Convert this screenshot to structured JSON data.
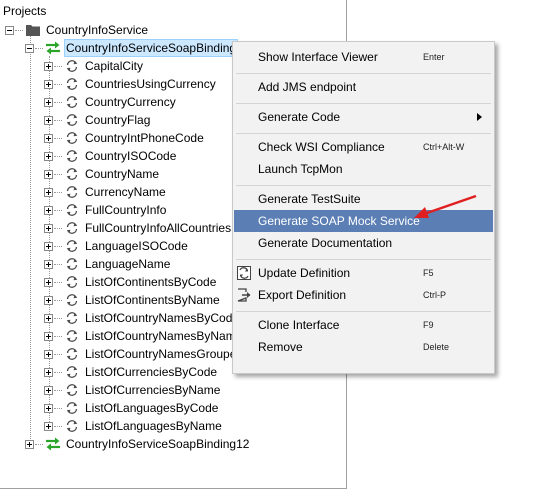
{
  "panel": {
    "header": "Projects",
    "project": "CountryInfoService",
    "binding": "CountryInfoServiceSoapBinding",
    "operations": [
      "CapitalCity",
      "CountriesUsingCurrency",
      "CountryCurrency",
      "CountryFlag",
      "CountryIntPhoneCode",
      "CountryISOCode",
      "CountryName",
      "CurrencyName",
      "FullCountryInfo",
      "FullCountryInfoAllCountries",
      "LanguageISOCode",
      "LanguageName",
      "ListOfContinentsByCode",
      "ListOfContinentsByName",
      "ListOfCountryNamesByCode",
      "ListOfCountryNamesByName",
      "ListOfCountryNamesGrouped",
      "ListOfCurrenciesByCode",
      "ListOfCurrenciesByName",
      "ListOfLanguagesByCode",
      "ListOfLanguagesByName"
    ],
    "binding2": "CountryInfoServiceSoapBinding12"
  },
  "menu": {
    "items": [
      {
        "label": "Show Interface Viewer",
        "shortcut": "Enter"
      },
      {
        "label": "Add JMS endpoint",
        "shortcut": ""
      },
      {
        "label": "Generate Code",
        "shortcut": ""
      },
      {
        "label": "Check WSI Compliance",
        "shortcut": "Ctrl+Alt-W"
      },
      {
        "label": "Launch TcpMon",
        "shortcut": ""
      },
      {
        "label": "Generate TestSuite",
        "shortcut": ""
      },
      {
        "label": "Generate SOAP Mock Service",
        "shortcut": ""
      },
      {
        "label": "Generate Documentation",
        "shortcut": ""
      },
      {
        "label": "Update Definition",
        "shortcut": "F5"
      },
      {
        "label": "Export Definition",
        "shortcut": "Ctrl-P"
      },
      {
        "label": "Clone Interface",
        "shortcut": "F9"
      },
      {
        "label": "Remove",
        "shortcut": "Delete"
      }
    ]
  },
  "colors": {
    "highlight": "#5b7fb4",
    "selection": "#cce8ff",
    "refresh_icon": "#4a4a4a",
    "binding_icon": "#2aa52a",
    "annotation_arrow": "#e02020"
  },
  "icons": {
    "project": "folder-icon",
    "binding": "interface-arrows-icon",
    "operation": "refresh-cycle-icon",
    "update": "update-definition-icon",
    "export": "export-definition-icon",
    "submenu": "submenu-arrow-icon",
    "annotation": "red-arrow-icon"
  }
}
